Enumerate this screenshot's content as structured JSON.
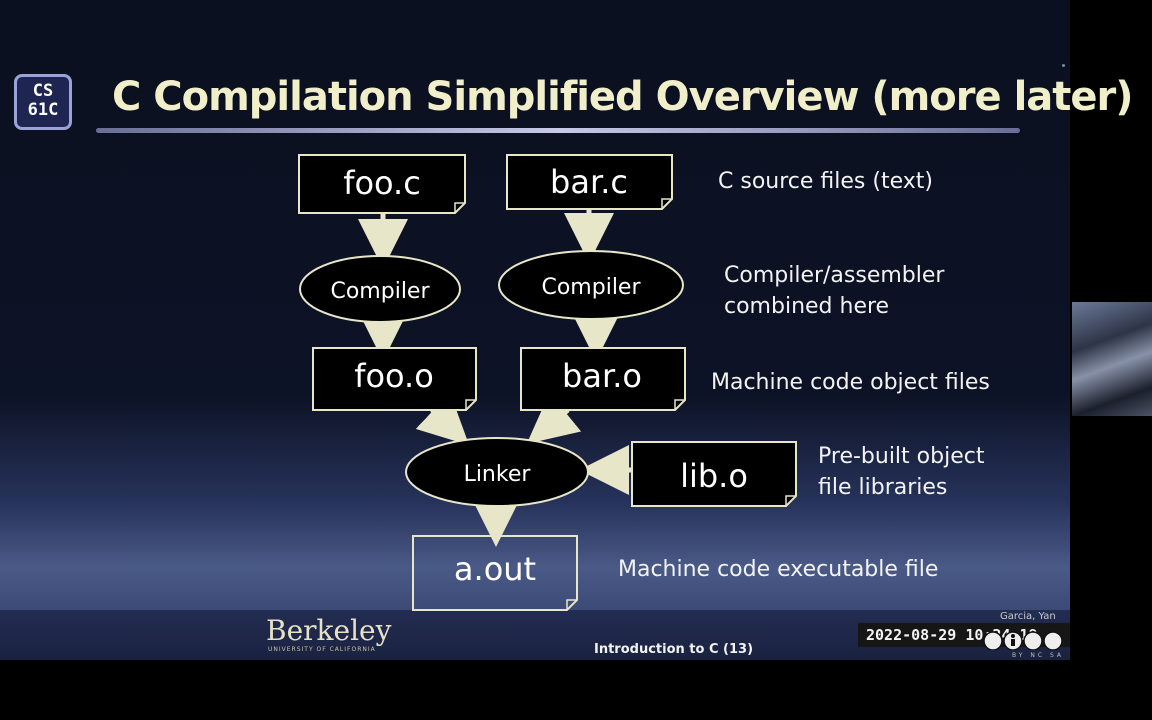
{
  "title": "C Compilation Simplified Overview (more later)",
  "logo": {
    "line1": "CS",
    "line2": "61C"
  },
  "nodes": {
    "foo_c": "foo.c",
    "bar_c": "bar.c",
    "compiler_left": "Compiler",
    "compiler_right": "Compiler",
    "foo_o": "foo.o",
    "bar_o": "bar.o",
    "linker": "Linker",
    "lib_o": "lib.o",
    "a_out": "a.out"
  },
  "notes": {
    "source": "C source files (text)",
    "compiler_line1": "Compiler/assembler",
    "compiler_line2": "combined here",
    "object": "Machine code object files",
    "prebuilt_line1": "Pre-built object",
    "prebuilt_line2": "file libraries",
    "executable": "Machine code executable file"
  },
  "footer": {
    "berkeley": "Berkeley",
    "berkeley_sub": "UNIVERSITY OF CALIFORNIA",
    "lecture": "Introduction to C (13)",
    "authors": "Garcia, Yan",
    "timestamp": "2022-08-29  10:24:19",
    "license": "BY   NC   SA"
  },
  "colors": {
    "title": "#f1efc9",
    "node_stroke": "#e8e6c8",
    "arrow": "#e8e6c8"
  }
}
